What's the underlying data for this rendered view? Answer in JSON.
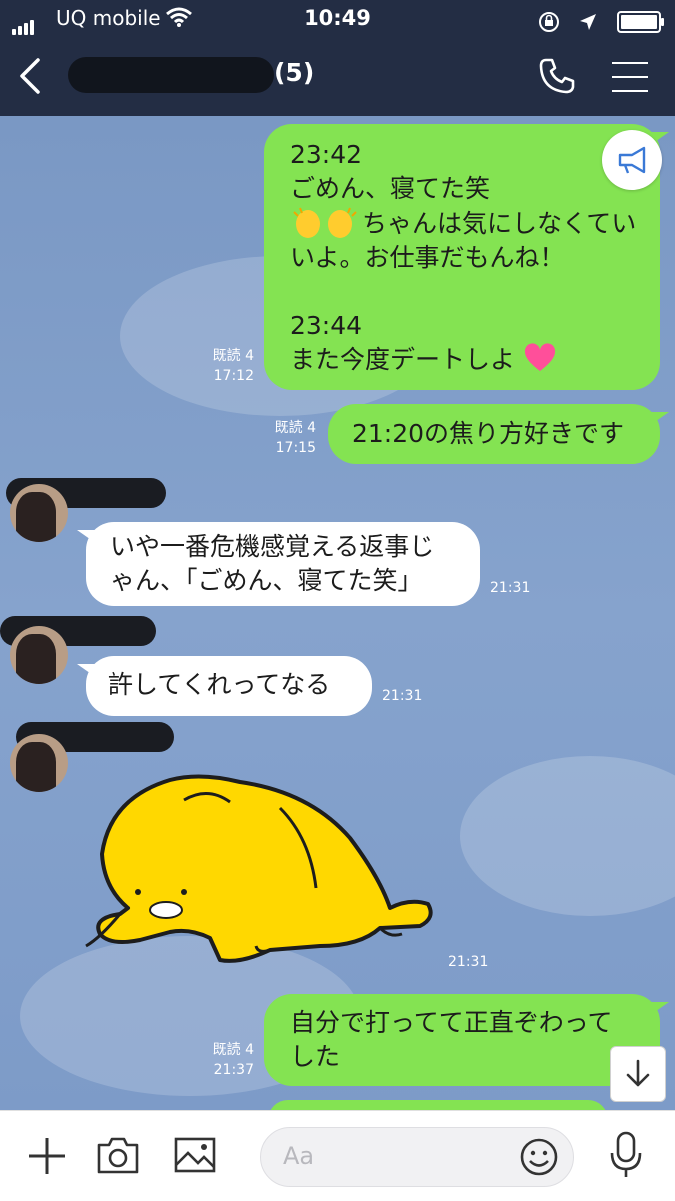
{
  "status_bar": {
    "carrier": "UQ mobile",
    "time": "10:49"
  },
  "header": {
    "member_count": "(5)"
  },
  "messages": {
    "m1": {
      "line1": "23:42",
      "line2": "ごめん、寝てた笑",
      "line3": "ちゃんは気にしなくてい",
      "line4": "いよ。お仕事だもんね！",
      "line5": "23:44",
      "line6": "また今度デートしよ",
      "read": "既読 4",
      "time": "17:12"
    },
    "m2": {
      "text": "21:20の焦り方好きです",
      "read": "既読 4",
      "time": "17:15"
    },
    "m3": {
      "line1": "いや一番危機感覚える返事じ",
      "line2": "ゃん、「ごめん、寝てた笑」",
      "time": "21:31"
    },
    "m4": {
      "text": "許してくれってなる",
      "time": "21:31"
    },
    "m5": {
      "sticker": "yellow-cat-sticker",
      "time": "21:31"
    },
    "m6": {
      "line1": "自分で打ってて正直ぞわって",
      "line2": "した",
      "read": "既読 4",
      "time": "21:37"
    }
  },
  "input": {
    "placeholder": "Aa"
  },
  "icons": [
    "back-icon",
    "phone-icon",
    "menu-icon",
    "megaphone-icon",
    "scroll-down-icon",
    "plus-icon",
    "camera-icon",
    "image-icon",
    "emoji-icon",
    "mic-icon"
  ],
  "colors": {
    "header_bg": "#232d44",
    "outgoing_bubble": "#84e352",
    "incoming_bubble": "#ffffff",
    "chat_bg": "#7b9ac8"
  }
}
